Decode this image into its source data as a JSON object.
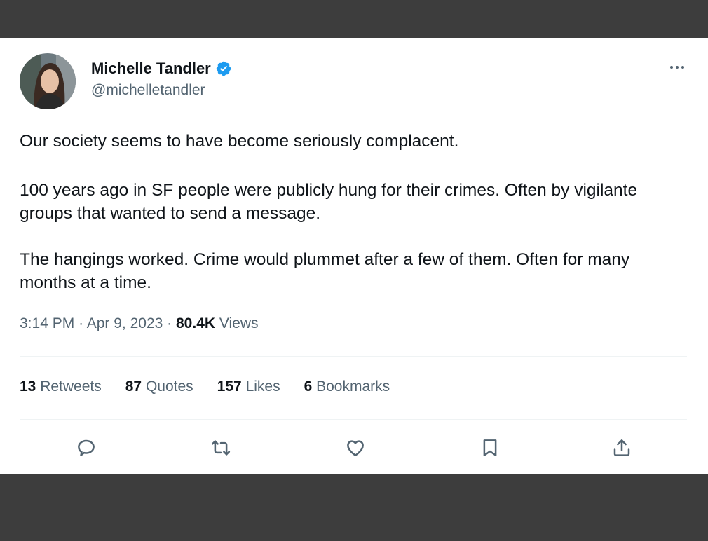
{
  "tweet": {
    "author_name": "Michelle Tandler",
    "author_handle": "@michelletandler",
    "paragraphs": [
      "Our society seems to have become seriously complacent.",
      "100 years ago in SF people were publicly hung for their crimes. Often by vigilante groups that wanted to send a message.",
      "The hangings worked. Crime would plummet after a few of them. Often for many months at a time."
    ],
    "time": "3:14 PM",
    "date": "Apr 9, 2023",
    "views_count": "80.4K",
    "views_label": "Views"
  },
  "stats": {
    "retweets_count": "13",
    "retweets_label": "Retweets",
    "quotes_count": "87",
    "quotes_label": "Quotes",
    "likes_count": "157",
    "likes_label": "Likes",
    "bookmarks_count": "6",
    "bookmarks_label": "Bookmarks"
  },
  "icons": {
    "verified": "verified-badge-icon",
    "more": "more-options-icon",
    "reply": "reply-icon",
    "retweet": "retweet-icon",
    "like": "like-icon",
    "bookmark": "bookmark-icon",
    "share": "share-icon"
  },
  "colors": {
    "accent": "#1d9bf0",
    "text_primary": "#0f1419",
    "text_secondary": "#536471",
    "frame": "#3d3d3d"
  }
}
